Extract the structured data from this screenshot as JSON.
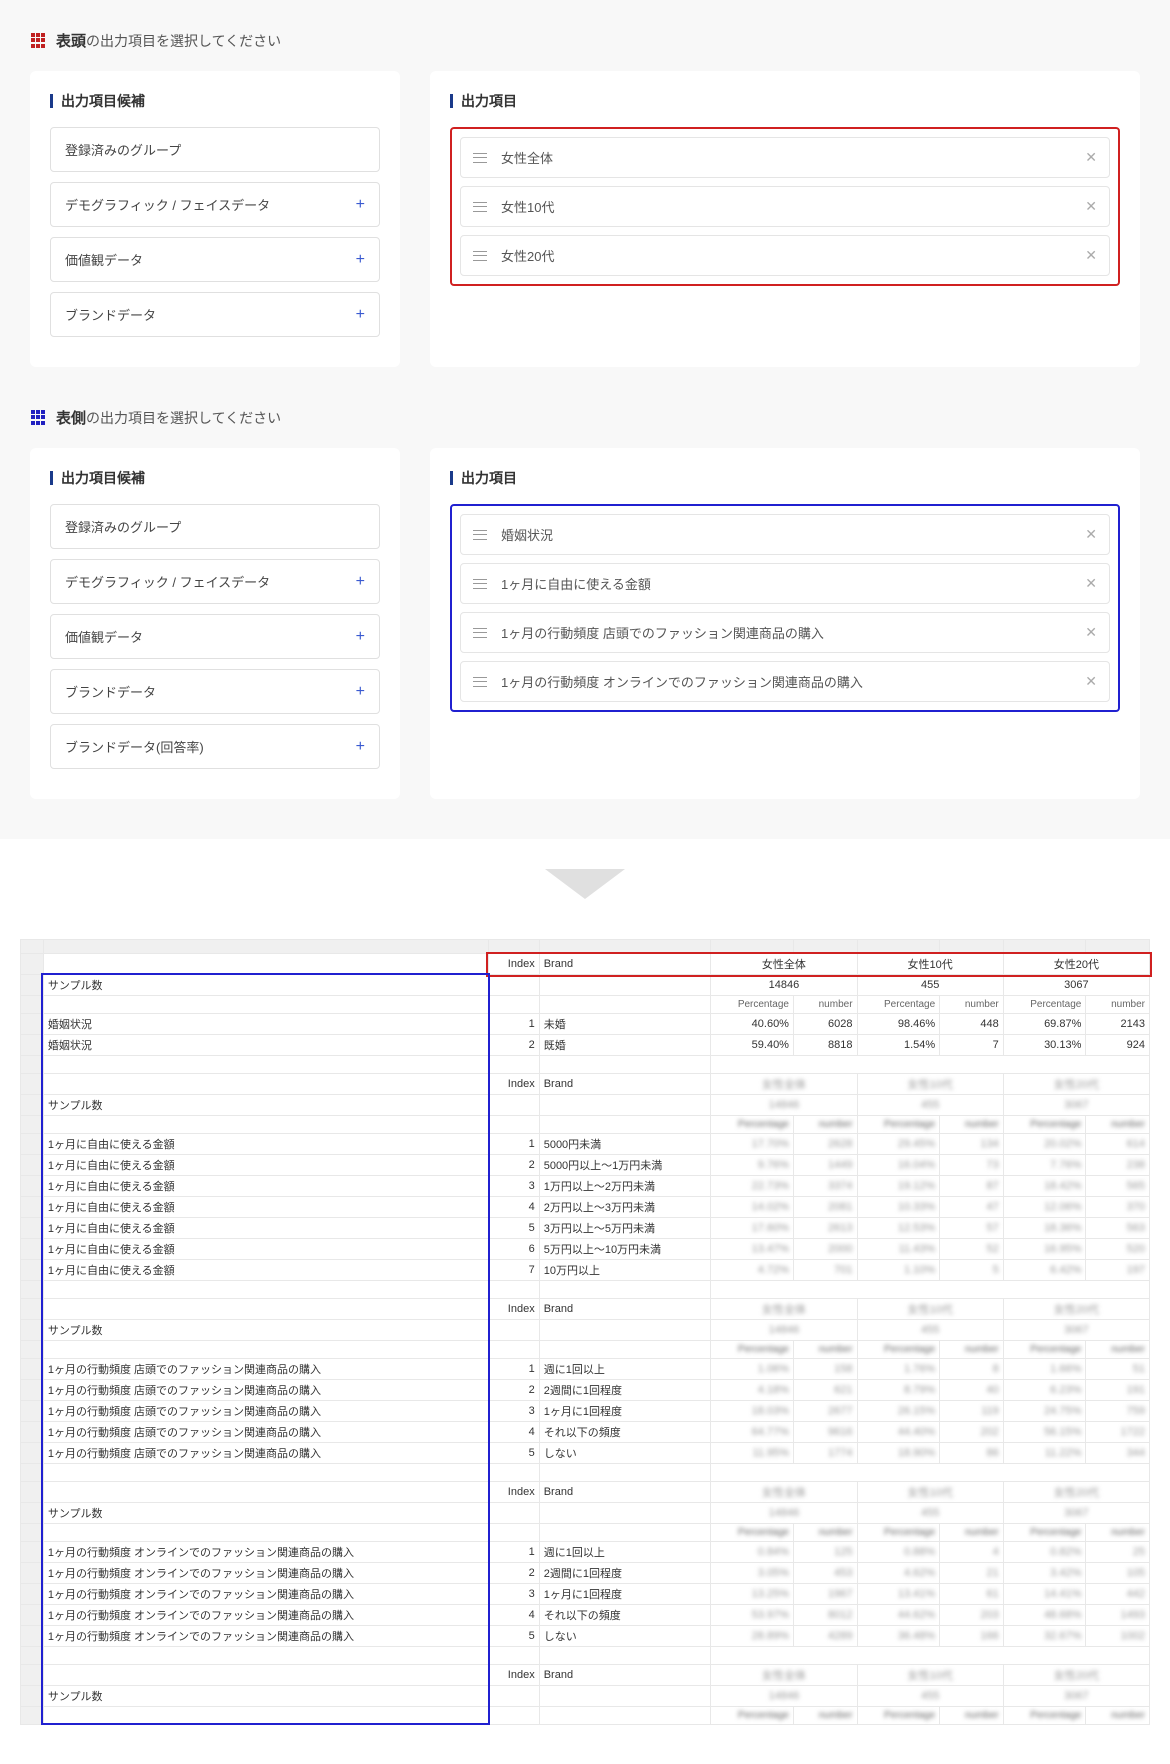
{
  "section1": {
    "title_bold": "表頭",
    "title_rest": "の出力項目を選択してください",
    "candidates_title": "出力項目候補",
    "selected_title": "出力項目",
    "candidates": [
      {
        "label": "登録済みのグループ",
        "expandable": false
      },
      {
        "label": "デモグラフィック / フェイスデータ",
        "expandable": true
      },
      {
        "label": "価値観データ",
        "expandable": true
      },
      {
        "label": "ブランドデータ",
        "expandable": true
      }
    ],
    "selected": [
      "女性全体",
      "女性10代",
      "女性20代"
    ]
  },
  "section2": {
    "title_bold": "表側",
    "title_rest": "の出力項目を選択してください",
    "candidates_title": "出力項目候補",
    "selected_title": "出力項目",
    "candidates": [
      {
        "label": "登録済みのグループ",
        "expandable": false
      },
      {
        "label": "デモグラフィック / フェイスデータ",
        "expandable": true
      },
      {
        "label": "価値観データ",
        "expandable": true
      },
      {
        "label": "ブランドデータ",
        "expandable": true
      },
      {
        "label": "ブランドデータ(回答率)",
        "expandable": true
      }
    ],
    "selected": [
      "婚姻状況",
      "1ヶ月に自由に使える金額",
      "1ヶ月の行動頻度 店頭でのファッション関連商品の購入",
      "1ヶ月の行動頻度 オンラインでのファッション関連商品の購入"
    ]
  },
  "spreadsheet": {
    "index_header": "Index",
    "brand_header": "Brand",
    "percentage_header": "Percentage",
    "number_header": "number",
    "sample_label": "サンプル数",
    "col_groups": [
      "女性全体",
      "女性10代",
      "女性20代"
    ],
    "sample_counts": [
      14846,
      455,
      3067
    ],
    "blocks": [
      {
        "row_label": "婚姻状況",
        "options": [
          "未婚",
          "既婚"
        ],
        "data": [
          [
            {
              "p": "40.60%",
              "n": 6028
            },
            {
              "p": "98.46%",
              "n": 448
            },
            {
              "p": "69.87%",
              "n": 2143
            }
          ],
          [
            {
              "p": "59.40%",
              "n": 8818
            },
            {
              "p": "1.54%",
              "n": 7
            },
            {
              "p": "30.13%",
              "n": 924
            }
          ]
        ]
      },
      {
        "row_label": "1ヶ月に自由に使える金額",
        "options": [
          "5000円未満",
          "5000円以上〜1万円未満",
          "1万円以上〜2万円未満",
          "2万円以上〜3万円未満",
          "3万円以上〜5万円未満",
          "5万円以上〜10万円未満",
          "10万円以上"
        ],
        "data": [
          [
            {
              "p": "17.70%",
              "n": 2628
            },
            {
              "p": "29.45%",
              "n": 134
            },
            {
              "p": "20.02%",
              "n": 614
            }
          ],
          [
            {
              "p": "9.76%",
              "n": 1449
            },
            {
              "p": "16.04%",
              "n": 73
            },
            {
              "p": "7.76%",
              "n": 238
            }
          ],
          [
            {
              "p": "22.73%",
              "n": 3374
            },
            {
              "p": "19.12%",
              "n": 87
            },
            {
              "p": "18.42%",
              "n": 565
            }
          ],
          [
            {
              "p": "14.02%",
              "n": 2081
            },
            {
              "p": "10.33%",
              "n": 47
            },
            {
              "p": "12.06%",
              "n": 370
            }
          ],
          [
            {
              "p": "17.60%",
              "n": 2613
            },
            {
              "p": "12.53%",
              "n": 57
            },
            {
              "p": "18.36%",
              "n": 563
            }
          ],
          [
            {
              "p": "13.47%",
              "n": 2000
            },
            {
              "p": "11.43%",
              "n": 52
            },
            {
              "p": "16.95%",
              "n": 520
            }
          ],
          [
            {
              "p": "4.72%",
              "n": 701
            },
            {
              "p": "1.10%",
              "n": 5
            },
            {
              "p": "6.42%",
              "n": 197
            }
          ]
        ]
      },
      {
        "row_label": "1ヶ月の行動頻度 店頭でのファッション関連商品の購入",
        "options": [
          "週に1回以上",
          "2週間に1回程度",
          "1ヶ月に1回程度",
          "それ以下の頻度",
          "しない"
        ],
        "data": [
          [
            {
              "p": "1.06%",
              "n": 158
            },
            {
              "p": "1.76%",
              "n": 8
            },
            {
              "p": "1.66%",
              "n": 51
            }
          ],
          [
            {
              "p": "4.18%",
              "n": 621
            },
            {
              "p": "8.79%",
              "n": 40
            },
            {
              "p": "6.23%",
              "n": 191
            }
          ],
          [
            {
              "p": "18.03%",
              "n": 2677
            },
            {
              "p": "26.15%",
              "n": 119
            },
            {
              "p": "24.75%",
              "n": 759
            }
          ],
          [
            {
              "p": "64.77%",
              "n": 9616
            },
            {
              "p": "44.40%",
              "n": 202
            },
            {
              "p": "56.15%",
              "n": 1722
            }
          ],
          [
            {
              "p": "11.95%",
              "n": 1774
            },
            {
              "p": "18.90%",
              "n": 86
            },
            {
              "p": "11.22%",
              "n": 344
            }
          ]
        ]
      },
      {
        "row_label": "1ヶ月の行動頻度 オンラインでのファッション関連商品の購入",
        "options": [
          "週に1回以上",
          "2週間に1回程度",
          "1ヶ月に1回程度",
          "それ以下の頻度",
          "しない"
        ],
        "data": [
          [
            {
              "p": "0.84%",
              "n": 125
            },
            {
              "p": "0.88%",
              "n": 4
            },
            {
              "p": "0.82%",
              "n": 25
            }
          ],
          [
            {
              "p": "3.05%",
              "n": 453
            },
            {
              "p": "4.62%",
              "n": 21
            },
            {
              "p": "3.42%",
              "n": 105
            }
          ],
          [
            {
              "p": "13.25%",
              "n": 1967
            },
            {
              "p": "13.41%",
              "n": 61
            },
            {
              "p": "14.41%",
              "n": 442
            }
          ],
          [
            {
              "p": "53.97%",
              "n": 8012
            },
            {
              "p": "44.62%",
              "n": 203
            },
            {
              "p": "48.68%",
              "n": 1493
            }
          ],
          [
            {
              "p": "28.89%",
              "n": 4289
            },
            {
              "p": "36.48%",
              "n": 166
            },
            {
              "p": "32.67%",
              "n": 1002
            }
          ]
        ]
      }
    ]
  }
}
